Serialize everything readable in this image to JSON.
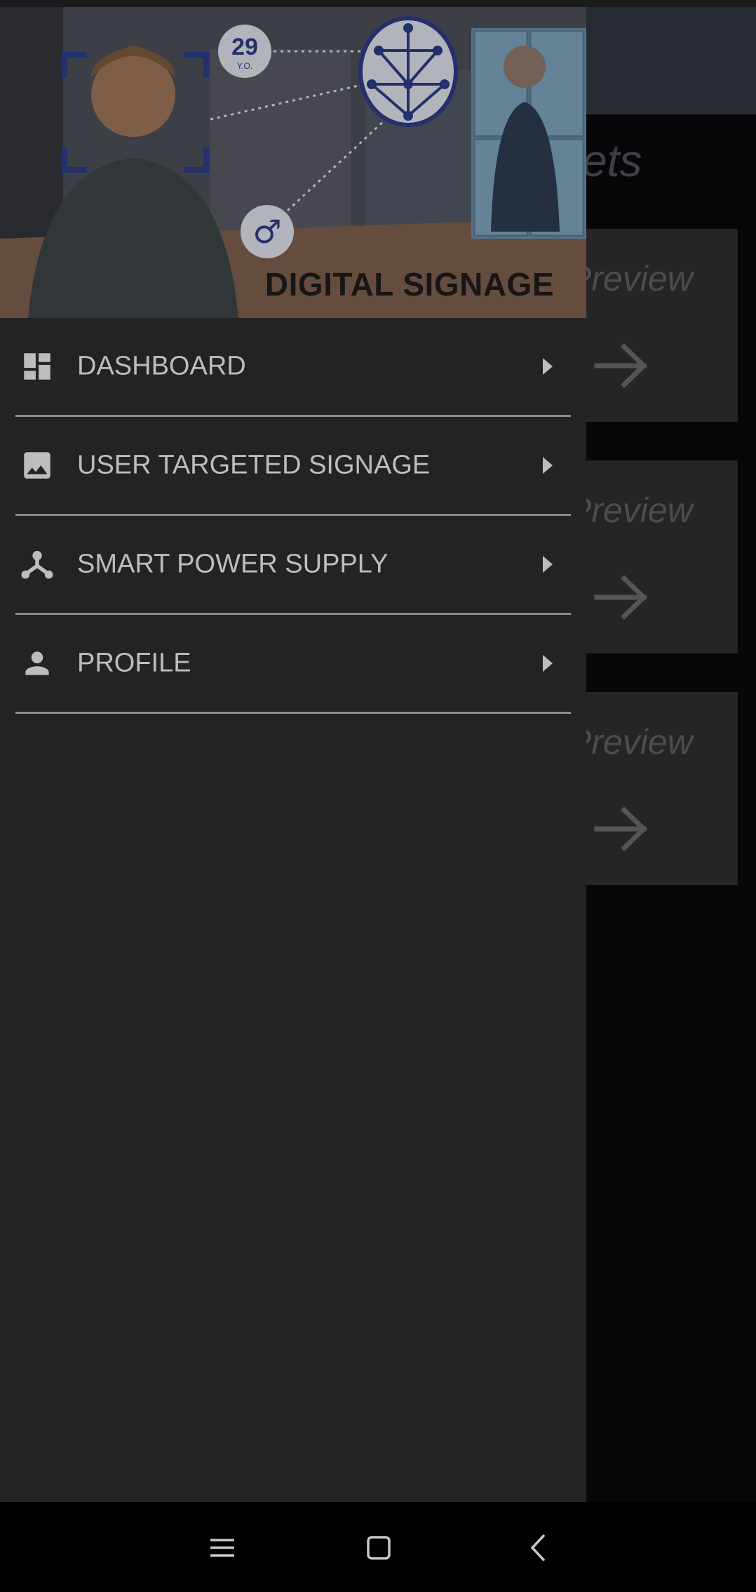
{
  "background_screen": {
    "title_partial": "ets",
    "cards": [
      {
        "label_partial": "Preview",
        "icon": "arrow-right-icon"
      },
      {
        "label_partial": "Preview",
        "icon": "arrow-right-icon"
      },
      {
        "label_partial": "Preview",
        "icon": "arrow-right-icon"
      }
    ]
  },
  "drawer": {
    "header": {
      "image": "digital-signage-illustration",
      "age_badge_number": "29",
      "age_badge_unit": "Y.O.",
      "gender_symbol": "♂",
      "title": "DIGITAL SIGNAGE"
    },
    "menu": [
      {
        "label": "DASHBOARD",
        "icon": "dashboard-icon"
      },
      {
        "label": "USER TARGETED SIGNAGE",
        "icon": "image-icon"
      },
      {
        "label": "SMART POWER SUPPLY",
        "icon": "hub-icon"
      },
      {
        "label": "PROFILE",
        "icon": "person-icon"
      }
    ]
  },
  "navigation_bar": {
    "buttons": [
      "menu-icon",
      "home-square-icon",
      "back-chevron-icon"
    ]
  },
  "colors": {
    "drawer_background": "#232323",
    "menu_text": "#bdbdbd",
    "divider": "#8b8b8b",
    "scrim_background": "#070709",
    "accent_blue": "#2c3a86"
  }
}
